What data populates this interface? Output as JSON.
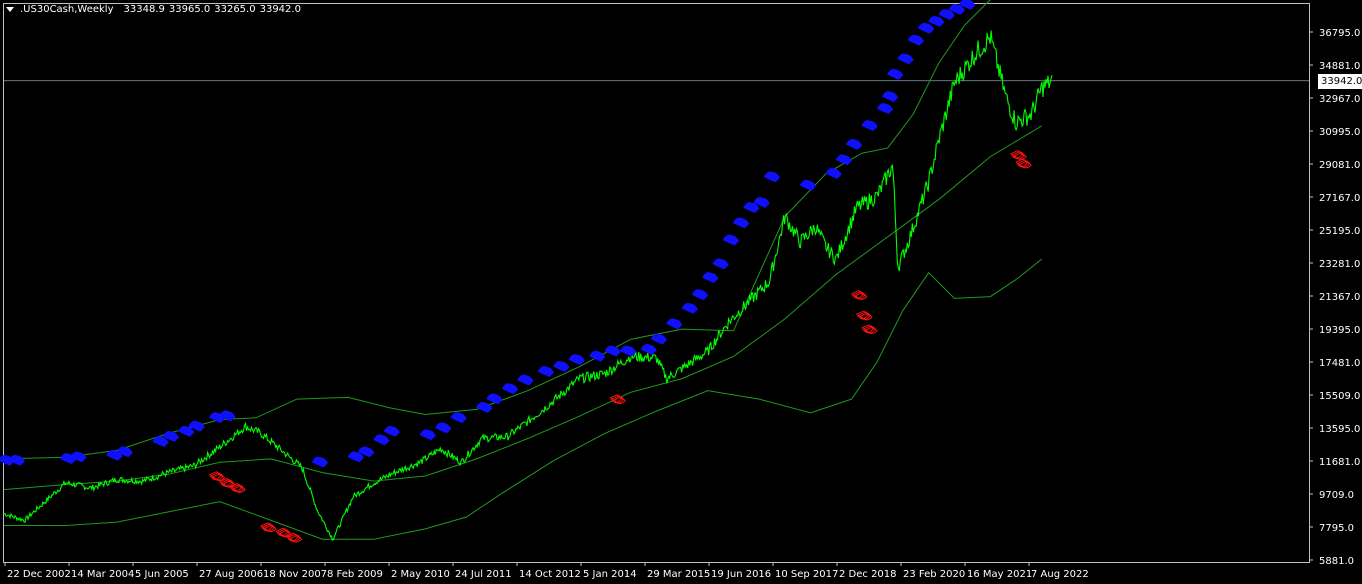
{
  "header": {
    "symbol": ".US30Cash,Weekly",
    "open": "33348.9",
    "high": "33965.0",
    "low": "33265.0",
    "close": "33942.0"
  },
  "current_price": "33942.0",
  "colors": {
    "background": "#000000",
    "price": "#00ff00",
    "bands": "#1f9a1f",
    "buy_arrow": "#1010ff",
    "sell_arrow": "#ff1010",
    "grid_border": "#c0c0c0",
    "current_line": "#8aa0b0"
  },
  "chart_data": {
    "type": "line",
    "title": "",
    "xlabel": "",
    "ylabel": "",
    "grid": false,
    "ylim": [
      5881.0,
      38709.0
    ],
    "y_ticks": [
      "36795.0",
      "34881.0",
      "32967.0",
      "30995.0",
      "29081.0",
      "27167.0",
      "25195.0",
      "23281.0",
      "21367.0",
      "19395.0",
      "17481.0",
      "15509.0",
      "13595.0",
      "11681.0",
      "9709.0",
      "7795.0",
      "5881.0"
    ],
    "x_ticks": [
      "22 Dec 2002",
      "14 Mar 2004",
      "5 Jun 2005",
      "27 Aug 2006",
      "18 Nov 2007",
      "8 Feb 2009",
      "2 May 2010",
      "24 Jul 2011",
      "14 Oct 2012",
      "5 Jan 2014",
      "29 Mar 2015",
      "19 Jun 2016",
      "10 Sep 2017",
      "2 Dec 2018",
      "23 Feb 2020",
      "16 May 2021",
      "7 Aug 2022"
    ],
    "series": [
      {
        "name": "",
        "x": [
          2002.8,
          2003.2,
          2003.6,
          2004.0,
          2004.5,
          2005.0,
          2005.5,
          2006.0,
          2006.5,
          2007.0,
          2007.5,
          2007.8,
          2008.2,
          2008.6,
          2008.9,
          2009.2,
          2009.6,
          2010.0,
          2010.4,
          2010.9,
          2011.3,
          2011.7,
          2012.1,
          2012.6,
          2013.0,
          2013.5,
          2014.0,
          2014.5,
          2015.0,
          2015.5,
          2015.7,
          2016.1,
          2016.5,
          2016.9,
          2017.3,
          2017.7,
          2018.0,
          2018.3,
          2018.6,
          2018.8,
          2019.0,
          2019.4,
          2019.8,
          2020.1,
          2020.2,
          2020.4,
          2020.8,
          2021.0,
          2021.3,
          2021.7,
          2022.0,
          2022.3,
          2022.5,
          2022.8,
          2023.0,
          2023.2
        ],
        "y": [
          8600,
          8200,
          9300,
          10400,
          10100,
          10600,
          10500,
          11000,
          11400,
          12500,
          13700,
          13300,
          12300,
          11300,
          8800,
          7100,
          9600,
          10400,
          11000,
          11600,
          12400,
          11600,
          13000,
          13100,
          14000,
          15200,
          16500,
          16800,
          17800,
          17700,
          16500,
          17300,
          18100,
          19800,
          21000,
          22200,
          26000,
          24500,
          25400,
          24200,
          23500,
          26500,
          27200,
          29000,
          23000,
          24500,
          28000,
          30500,
          33800,
          35500,
          36500,
          33000,
          31500,
          32000,
          33500,
          33942
        ]
      },
      {
        "name": "",
        "x": [
          2002.8,
          2004.0,
          2005.0,
          2006.0,
          2007.0,
          2008.0,
          2009.0,
          2010.0,
          2011.0,
          2012.0,
          2013.0,
          2014.0,
          2015.0,
          2016.0,
          2017.0,
          2018.0,
          2019.0,
          2020.0,
          2021.0,
          2022.0,
          2023.0
        ],
        "y": [
          10000,
          10300,
          10500,
          10900,
          11600,
          11800,
          11000,
          10500,
          10800,
          11800,
          13000,
          14300,
          15700,
          16500,
          17800,
          20000,
          22600,
          24800,
          27000,
          29500,
          31300
        ]
      },
      {
        "name": "",
        "x": [
          2002.8,
          2004.0,
          2005.0,
          2006.0,
          2007.0,
          2007.7,
          2008.5,
          2009.5,
          2010.3,
          2011.0,
          2012.0,
          2013.0,
          2014.0,
          2015.0,
          2016.0,
          2017.0,
          2018.0,
          2018.8,
          2019.5,
          2020.0,
          2020.5,
          2021.0,
          2021.5,
          2022.0,
          2023.0
        ],
        "y": [
          11800,
          11900,
          12300,
          13300,
          14100,
          14200,
          15300,
          15400,
          14800,
          14400,
          14700,
          15800,
          17200,
          18800,
          19400,
          19300,
          26000,
          28500,
          29700,
          30000,
          32000,
          35000,
          37200,
          38700,
          38800
        ]
      },
      {
        "name": "",
        "x": [
          2002.8,
          2004.0,
          2005.0,
          2006.0,
          2007.0,
          2008.0,
          2009.0,
          2010.0,
          2011.0,
          2011.8,
          2012.5,
          2013.5,
          2014.5,
          2015.5,
          2016.5,
          2017.5,
          2018.5,
          2019.3,
          2019.8,
          2020.3,
          2020.8,
          2021.3,
          2022.0,
          2022.5,
          2023.0
        ],
        "y": [
          7900,
          7900,
          8100,
          8700,
          9300,
          8200,
          7100,
          7100,
          7700,
          8400,
          9800,
          11700,
          13300,
          14600,
          15800,
          15300,
          14500,
          15300,
          17500,
          20500,
          22700,
          21200,
          21300,
          22300,
          23500
        ]
      }
    ],
    "buy_arrows_x": [
      2002.8,
      2003.0,
      2004.0,
      2004.2,
      2004.9,
      2005.1,
      2005.8,
      2006.0,
      2006.3,
      2006.5,
      2006.9,
      2007.1,
      2008.9,
      2009.6,
      2009.8,
      2010.1,
      2010.3,
      2011.0,
      2011.3,
      2011.6,
      2012.1,
      2012.3,
      2012.6,
      2012.9,
      2013.3,
      2013.6,
      2013.9,
      2014.3,
      2014.6,
      2014.9,
      2015.3,
      2015.5,
      2015.8,
      2016.1,
      2016.3,
      2016.5,
      2016.7,
      2016.9,
      2017.1,
      2017.3,
      2017.5,
      2017.7,
      2018.4,
      2018.9,
      2019.1,
      2019.3,
      2019.6,
      2019.9,
      2020.0,
      2020.1,
      2020.3,
      2020.5,
      2020.7,
      2020.9,
      2021.1,
      2021.3,
      2021.5
    ],
    "buy_arrows_y": [
      11900,
      11900,
      12000,
      12100,
      12200,
      12400,
      13000,
      13300,
      13600,
      13900,
      14400,
      14500,
      11800,
      12100,
      12400,
      13100,
      13600,
      13400,
      13800,
      14400,
      15000,
      15500,
      16100,
      16600,
      17100,
      17400,
      17800,
      18000,
      18300,
      18300,
      18400,
      19000,
      19900,
      20800,
      21600,
      22600,
      23400,
      24800,
      25800,
      26700,
      27000,
      28500,
      28000,
      28700,
      29500,
      30400,
      31500,
      32500,
      33200,
      34500,
      35400,
      36500,
      37200,
      37600,
      38000,
      38300,
      38600
    ],
    "sell_arrows_x": [
      2006.9,
      2007.1,
      2007.3,
      2007.9,
      2008.2,
      2008.4,
      2014.7,
      2019.4,
      2019.5,
      2019.6,
      2022.5,
      2022.6
    ],
    "sell_arrows_y": [
      10700,
      10300,
      10000,
      7700,
      7400,
      7100,
      15200,
      21300,
      20100,
      19300,
      29500,
      29000
    ]
  }
}
